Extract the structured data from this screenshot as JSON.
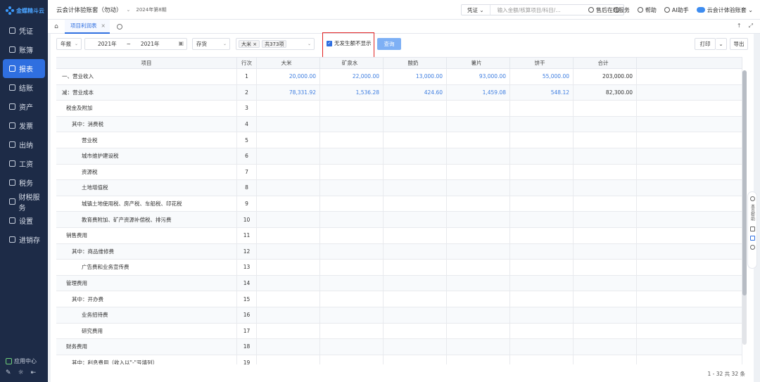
{
  "sidebar": {
    "logo": "金蝶精斗云",
    "items": [
      {
        "label": "凭证",
        "active": false
      },
      {
        "label": "账簿",
        "active": false
      },
      {
        "label": "报表",
        "active": true
      },
      {
        "label": "结账",
        "active": false
      },
      {
        "label": "资产",
        "active": false
      },
      {
        "label": "发票",
        "active": false
      },
      {
        "label": "出纳",
        "active": false
      },
      {
        "label": "工资",
        "active": false
      },
      {
        "label": "税务",
        "active": false
      },
      {
        "label": "财税服务",
        "active": false
      },
      {
        "label": "设置",
        "active": false
      },
      {
        "label": "进销存",
        "active": false
      }
    ],
    "app_center": "应用中心"
  },
  "header": {
    "account": "云会计体验账套（勿动）",
    "period": "2024年第8期",
    "search_type": "凭证",
    "search_placeholder": "输入金额/核算项目/科目/…",
    "service": "售后在线服务",
    "help": "帮助",
    "ai": "AI助手",
    "user": "云会计体验账套"
  },
  "tabs": [
    {
      "label": "项目利润表",
      "active": true
    }
  ],
  "toolbar": {
    "period_type": "年报",
    "from_year": "2021年",
    "range_sep": "~",
    "to_year": "2021年",
    "category": "存货",
    "tag1": "大米",
    "tag2": "共373项",
    "hide_zero_label": "无发生额不显示",
    "query": "查询",
    "print": "打印",
    "export": "导出"
  },
  "table": {
    "headers": [
      "项目",
      "行次",
      "大米",
      "矿泉水",
      "酸奶",
      "薯片",
      "饼干",
      "合计"
    ],
    "rows": [
      {
        "item": "一、营业收入",
        "indent": 0,
        "no": "1",
        "v": [
          "20,000.00",
          "22,000.00",
          "13,000.00",
          "93,000.00",
          "55,000.00"
        ],
        "total": "203,000.00"
      },
      {
        "item": "减：营业成本",
        "indent": 0,
        "no": "2",
        "v": [
          "78,331.92",
          "1,536.28",
          "424.60",
          "1,459.08",
          "548.12"
        ],
        "total": "82,300.00"
      },
      {
        "item": "税金及附加",
        "indent": 1,
        "no": "3",
        "v": [
          "",
          "",
          "",
          "",
          ""
        ],
        "total": ""
      },
      {
        "item": "其中：消费税",
        "indent": 2,
        "no": "4",
        "v": [
          "",
          "",
          "",
          "",
          ""
        ],
        "total": ""
      },
      {
        "item": "营业税",
        "indent": 3,
        "no": "5",
        "v": [
          "",
          "",
          "",
          "",
          ""
        ],
        "total": ""
      },
      {
        "item": "城市维护建设税",
        "indent": 3,
        "no": "6",
        "v": [
          "",
          "",
          "",
          "",
          ""
        ],
        "total": ""
      },
      {
        "item": "资源税",
        "indent": 3,
        "no": "7",
        "v": [
          "",
          "",
          "",
          "",
          ""
        ],
        "total": ""
      },
      {
        "item": "土地增值税",
        "indent": 3,
        "no": "8",
        "v": [
          "",
          "",
          "",
          "",
          ""
        ],
        "total": ""
      },
      {
        "item": "城镇土地使用税、房产税、车船税、印花税",
        "indent": 3,
        "no": "9",
        "v": [
          "",
          "",
          "",
          "",
          ""
        ],
        "total": ""
      },
      {
        "item": "教育费附加、矿产资源补偿税、排污费",
        "indent": 3,
        "no": "10",
        "v": [
          "",
          "",
          "",
          "",
          ""
        ],
        "total": ""
      },
      {
        "item": "销售费用",
        "indent": 1,
        "no": "11",
        "v": [
          "",
          "",
          "",
          "",
          ""
        ],
        "total": ""
      },
      {
        "item": "其中：商品维修费",
        "indent": 2,
        "no": "12",
        "v": [
          "",
          "",
          "",
          "",
          ""
        ],
        "total": ""
      },
      {
        "item": "广告费和业务宣传费",
        "indent": 3,
        "no": "13",
        "v": [
          "",
          "",
          "",
          "",
          ""
        ],
        "total": ""
      },
      {
        "item": "管理费用",
        "indent": 1,
        "no": "14",
        "v": [
          "",
          "",
          "",
          "",
          ""
        ],
        "total": ""
      },
      {
        "item": "其中：开办费",
        "indent": 2,
        "no": "15",
        "v": [
          "",
          "",
          "",
          "",
          ""
        ],
        "total": ""
      },
      {
        "item": "业务招待费",
        "indent": 3,
        "no": "16",
        "v": [
          "",
          "",
          "",
          "",
          ""
        ],
        "total": ""
      },
      {
        "item": "研究费用",
        "indent": 3,
        "no": "17",
        "v": [
          "",
          "",
          "",
          "",
          ""
        ],
        "total": ""
      },
      {
        "item": "财务费用",
        "indent": 1,
        "no": "18",
        "v": [
          "",
          "",
          "",
          "",
          ""
        ],
        "total": ""
      },
      {
        "item": "其中：利息费用（收入以\"-\"号填列）",
        "indent": 2,
        "no": "19",
        "v": [
          "",
          "",
          "",
          "",
          ""
        ],
        "total": ""
      }
    ]
  },
  "pager": "1 - 32 共 32 条",
  "float_panel": {
    "help": "本页帮助"
  }
}
